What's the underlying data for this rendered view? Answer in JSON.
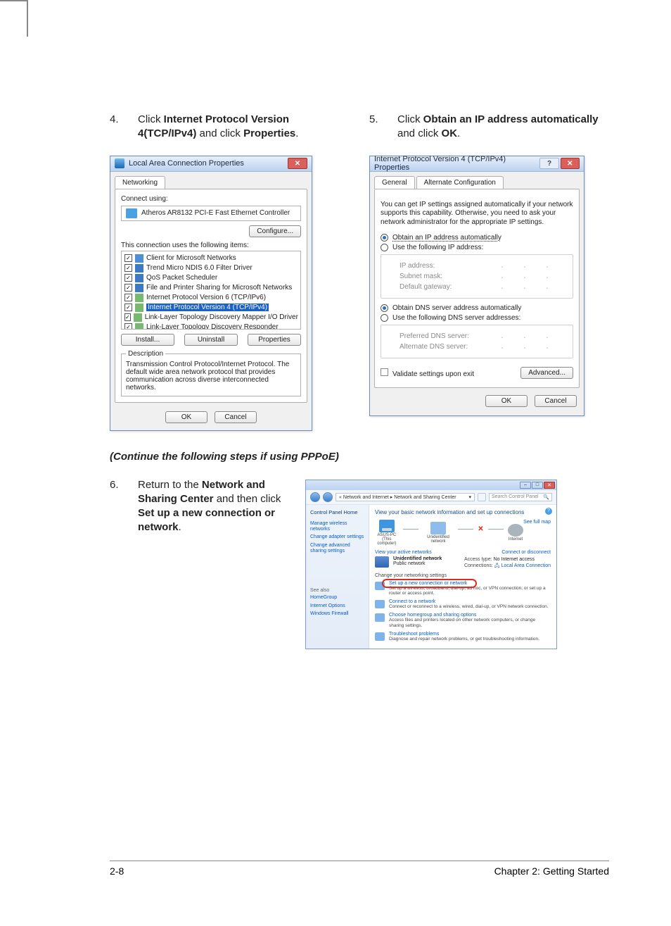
{
  "step4": {
    "num": "4.",
    "pre": "Click ",
    "bold1": "Internet Protocol Version 4(TCP/IPv4)",
    "mid": " and click ",
    "bold2": "Properties",
    "post": "."
  },
  "step5": {
    "num": "5.",
    "pre": "Click ",
    "bold1": "Obtain an IP address automatically",
    "mid": " and click ",
    "bold2": "OK",
    "post": "."
  },
  "step6": {
    "num": "6.",
    "pre": "Return to the ",
    "bold1": "Network and Sharing Center",
    "mid": " and then click ",
    "bold2": "Set up a new connection or network",
    "post": "."
  },
  "continue_note": "(Continue the following steps if using PPPoE)",
  "dlg_left": {
    "title": "Local Area Connection Properties",
    "tab": "Networking",
    "connect_using": "Connect using:",
    "adapter": "Atheros AR8132 PCI-E Fast Ethernet Controller",
    "configure": "Configure...",
    "uses": "This connection uses the following items:",
    "items": [
      "Client for Microsoft Networks",
      "Trend Micro NDIS 6.0 Filter Driver",
      "QoS Packet Scheduler",
      "File and Printer Sharing for Microsoft Networks",
      "Internet Protocol Version 6 (TCP/IPv6)",
      "Internet Protocol Version 4 (TCP/IPv4)",
      "Link-Layer Topology Discovery Mapper I/O Driver",
      "Link-Layer Topology Discovery Responder"
    ],
    "install": "Install...",
    "uninstall": "Uninstall",
    "properties": "Properties",
    "desc_legend": "Description",
    "desc": "Transmission Control Protocol/Internet Protocol. The default wide area network protocol that provides communication across diverse interconnected networks.",
    "ok": "OK",
    "cancel": "Cancel"
  },
  "dlg_right": {
    "title": "Internet Protocol Version 4 (TCP/IPv4) Properties",
    "tab_general": "General",
    "tab_alt": "Alternate Configuration",
    "explain": "You can get IP settings assigned automatically if your network supports this capability. Otherwise, you need to ask your network administrator for the appropriate IP settings.",
    "obtain_ip": "Obtain an IP address automatically",
    "use_ip": "Use the following IP address:",
    "ip_address": "IP address:",
    "subnet": "Subnet mask:",
    "gateway": "Default gateway:",
    "obtain_dns": "Obtain DNS server address automatically",
    "use_dns": "Use the following DNS server addresses:",
    "pref_dns": "Preferred DNS server:",
    "alt_dns": "Alternate DNS server:",
    "validate": "Validate settings upon exit",
    "advanced": "Advanced...",
    "ok": "OK",
    "cancel": "Cancel"
  },
  "nsc": {
    "breadcrumb": "« Network and Internet  ▸  Network and Sharing Center",
    "search_ph": "Search Control Panel",
    "cp_home": "Control Panel Home",
    "side": {
      "a": "Manage wireless networks",
      "b": "Change adapter settings",
      "c": "Change advanced sharing settings"
    },
    "see_also_h": "See also",
    "see_also": {
      "a": "HomeGroup",
      "b": "Internet Options",
      "c": "Windows Firewall"
    },
    "heading": "View your basic network information and set up connections",
    "see_full_map": "See full map",
    "nodes": {
      "pc": "ASUS-PC",
      "pc_sub": "(This computer)",
      "hub": "Unidentified network",
      "net": "Internet"
    },
    "view_active": "View your active networks",
    "connect_disconnect": "Connect or disconnect",
    "net_name": "Unidentified network",
    "net_type": "Public network",
    "access_type_k": "Access type:",
    "access_type_v": "No Internet access",
    "connections_k": "Connections:",
    "connections_v": "Local Area Connection",
    "change_settings": "Change your networking settings",
    "tasks": {
      "setup_t": "Set up a new connection or network",
      "setup_s": "Set up a wireless, broadband, dial-up, ad hoc, or VPN connection; or set up a router or access point.",
      "conn_t": "Connect to a network",
      "conn_s": "Connect or reconnect to a wireless, wired, dial-up, or VPN network connection.",
      "home_t": "Choose homegroup and sharing options",
      "home_s": "Access files and printers located on other network computers, or change sharing settings.",
      "trbl_t": "Troubleshoot problems",
      "trbl_s": "Diagnose and repair network problems, or get troubleshooting information."
    }
  },
  "footer": {
    "left": "2-8",
    "right": "Chapter 2: Getting Started"
  }
}
